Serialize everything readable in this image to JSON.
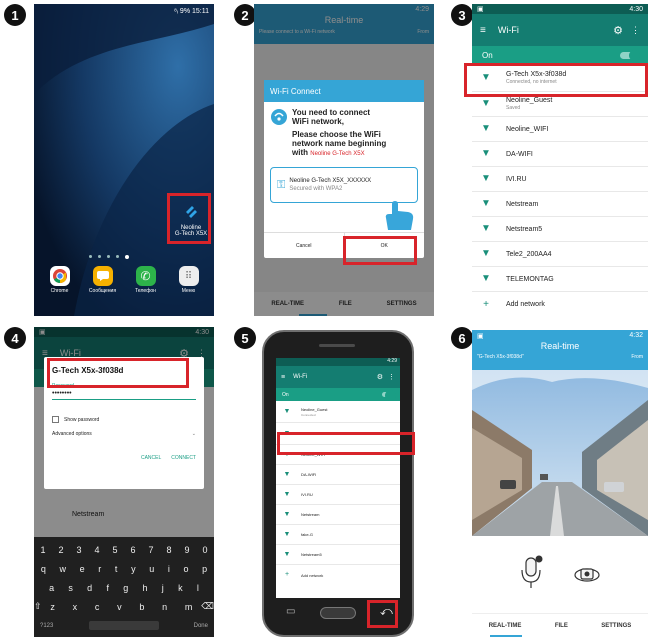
{
  "steps": [
    "1",
    "2",
    "3",
    "4",
    "5",
    "6"
  ],
  "colors": {
    "highlight": "#d8242a",
    "teal": "#1a9e85",
    "realtime_blue": "#35a5d6"
  },
  "s1": {
    "status": "⁸ᵢ 9% 15:11",
    "widget": {
      "name": "Neoline",
      "model": "G-Tech X5X"
    },
    "apps": [
      "Chrome",
      "Сообщения",
      "Телефон",
      "Меню"
    ]
  },
  "s2": {
    "title": "Real-time",
    "subtitle": "Please connect to a Wi-Fi network",
    "right": "From",
    "status": "4:29",
    "dialog": {
      "title": "Wi-Fi Connect",
      "line1": "You need to connect",
      "line2": "WiFi network,",
      "line3": "Please choose the WiFi",
      "line4": "network name beginning",
      "line5": "with",
      "brand": "Neoline G-Tech X5X",
      "net_name": "Neoline G-Tech X5X_XXXXXX",
      "net_sub": "Secured with WPA2",
      "cancel": "Cancel",
      "ok": "OK"
    },
    "tabs": [
      "REAL-TIME",
      "FILE",
      "SETTINGS"
    ]
  },
  "s3": {
    "status": "4:30",
    "title": "Wi-Fi",
    "on": "On",
    "networks": [
      {
        "name": "G-Tech X5x-3f038d",
        "sub": "Connected, no internet"
      },
      {
        "name": "Neoline_Guest",
        "sub": "Saved"
      },
      {
        "name": "Neoline_WIFI",
        "sub": ""
      },
      {
        "name": "DA-WIFI",
        "sub": ""
      },
      {
        "name": "IVI.RU",
        "sub": ""
      },
      {
        "name": "Netstream",
        "sub": ""
      },
      {
        "name": "Netstream5",
        "sub": ""
      },
      {
        "name": "Tele2_200AA4",
        "sub": ""
      },
      {
        "name": "TELEMONTAG",
        "sub": ""
      }
    ],
    "add": "Add network"
  },
  "s4": {
    "status": "4:30",
    "title": "Wi-Fi",
    "on": "On",
    "dialog": {
      "ssid": "G-Tech X5x-3f038d",
      "password_label": "Password",
      "password_value": "••••••••",
      "show_password": "Show password",
      "advanced": "Advanced options",
      "cancel": "CANCEL",
      "connect": "CONNECT"
    },
    "behind": "Netstream",
    "keyboard": {
      "row1": [
        "1",
        "2",
        "3",
        "4",
        "5",
        "6",
        "7",
        "8",
        "9",
        "0"
      ],
      "row2": [
        "q",
        "w",
        "e",
        "r",
        "t",
        "y",
        "u",
        "i",
        "o",
        "p"
      ],
      "row3": [
        "a",
        "s",
        "d",
        "f",
        "g",
        "h",
        "j",
        "k",
        "l"
      ],
      "row4": [
        "z",
        "x",
        "c",
        "v",
        "b",
        "n",
        "m"
      ],
      "sym": "?123",
      "done": "Done"
    }
  },
  "s5": {
    "status": "4:29",
    "title": "Wi-Fi",
    "on": "On",
    "networks": [
      {
        "name": "Neoline_Guest",
        "sub": "Connected"
      },
      {
        "name": "G-Tech X5x-3f038d",
        "sub": ""
      },
      {
        "name": "Neoline_WIFI",
        "sub": ""
      },
      {
        "name": "DA-WIFI",
        "sub": ""
      },
      {
        "name": "IVI.RU",
        "sub": ""
      },
      {
        "name": "Netstream",
        "sub": ""
      },
      {
        "name": "fake-G",
        "sub": ""
      },
      {
        "name": "Netstream5",
        "sub": ""
      }
    ],
    "add": "Add network"
  },
  "s6": {
    "status": "4:32",
    "title": "Real-time",
    "subtitle": "\"G-Tech X5x-3f038d\"",
    "right": "From",
    "tabs": [
      "REAL-TIME",
      "FILE",
      "SETTINGS"
    ]
  }
}
